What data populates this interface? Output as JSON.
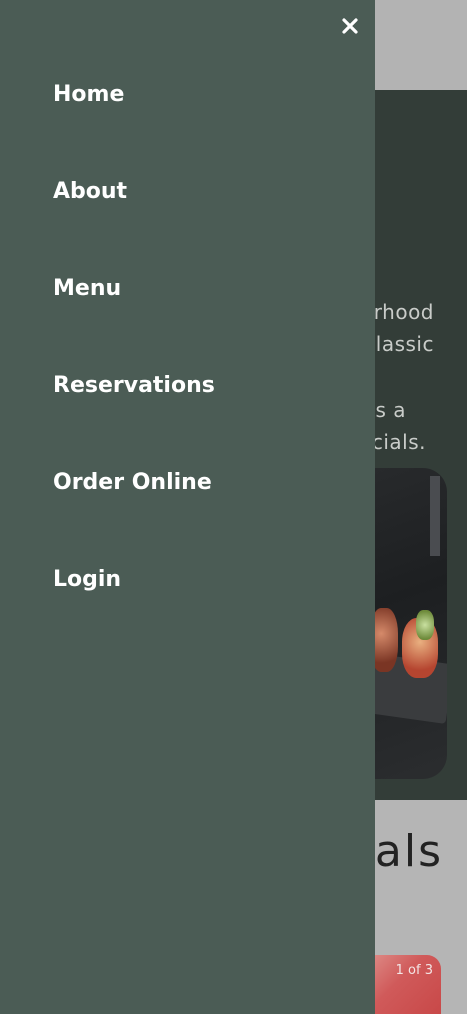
{
  "drawer": {
    "close_icon": "close-icon",
    "nav_items": [
      {
        "label": "Home"
      },
      {
        "label": "About"
      },
      {
        "label": "Menu"
      },
      {
        "label": "Reservations"
      },
      {
        "label": "Order Online"
      },
      {
        "label": "Login"
      }
    ]
  },
  "background": {
    "hero_lines": [
      "rhood",
      "lassic",
      "es a",
      "cials."
    ],
    "specials_title_partial": "ials",
    "card_counter": "1 of 3"
  },
  "colors": {
    "drawer_bg": "#4b5c55",
    "hero_bg": "#333d38",
    "page_bg": "#b5b5b5",
    "nav_text": "#ffffff"
  }
}
